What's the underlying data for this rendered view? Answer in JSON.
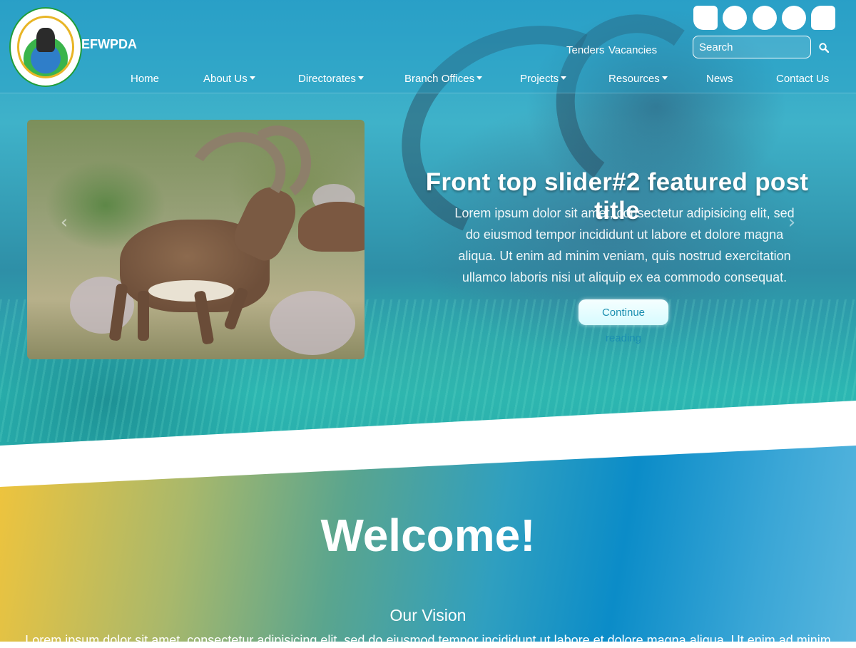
{
  "header": {
    "brand": "EFWPDA",
    "top_links": [
      "Tenders",
      "Vacancies"
    ],
    "search_placeholder": "Search",
    "nav": [
      {
        "label": "Home",
        "dropdown": false
      },
      {
        "label": "About Us",
        "dropdown": true
      },
      {
        "label": "Directorates",
        "dropdown": true
      },
      {
        "label": "Branch Offices",
        "dropdown": true
      },
      {
        "label": "Projects",
        "dropdown": true
      },
      {
        "label": "Resources",
        "dropdown": true
      },
      {
        "label": "News",
        "dropdown": false
      },
      {
        "label": "Contact Us",
        "dropdown": false
      }
    ]
  },
  "slider": {
    "title": "Front top slider#2 featured post title",
    "text": "Lorem ipsum dolor sit amet, consectetur adipisicing elit, sed do eiusmod tempor incididunt ut labore et dolore magna aliqua. Ut enim ad minim veniam, quis nostrud exercitation ullamco laboris nisi ut aliquip ex ea commodo consequat.",
    "button": "Continue reading",
    "prev_icon": "chevron-left-icon",
    "next_icon": "chevron-right-icon"
  },
  "welcome": {
    "title": "Welcome!",
    "vision_title": "Our Vision",
    "vision_text": "Lorem ipsum dolor sit amet, consectetur adipisicing elit, sed do eiusmod tempor incididunt ut labore et dolore magna aliqua. Ut enim ad minim"
  },
  "colors": {
    "accent": "#1b8fb0",
    "gradient_start": "#f0c43c",
    "gradient_end": "#0b8cc8"
  }
}
